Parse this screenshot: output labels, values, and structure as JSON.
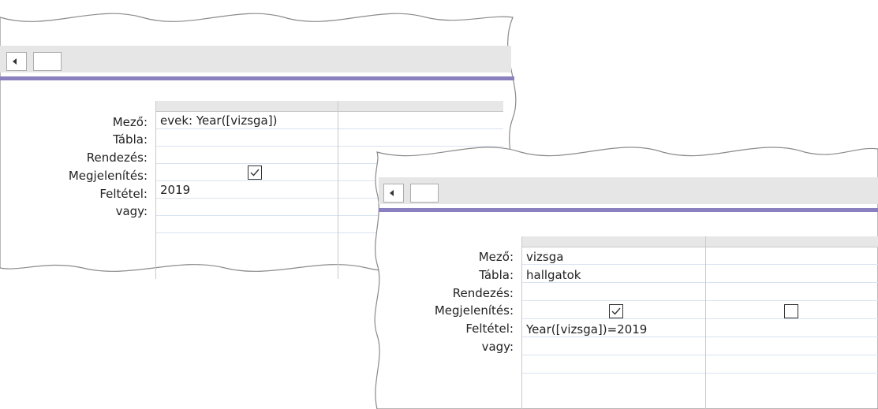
{
  "labels": [
    "Mező:",
    "Tábla:",
    "Rendezés:",
    "Megjelenítés:",
    "Feltétel:",
    "vagy:"
  ],
  "panel1": {
    "col1": {
      "field": "evek: Year([vizsga])",
      "table": "",
      "sort": "",
      "show": true,
      "criteria": "2019",
      "or": ""
    }
  },
  "panel2": {
    "col1": {
      "field": "vizsga",
      "table": "hallgatok",
      "sort": "",
      "show": true,
      "criteria": "Year([vizsga])=2019",
      "or": ""
    },
    "col2": {
      "show": false
    }
  },
  "icons": {
    "scroll_left": "chevron-left-icon",
    "checkbox_checked": "checkmark-icon"
  }
}
